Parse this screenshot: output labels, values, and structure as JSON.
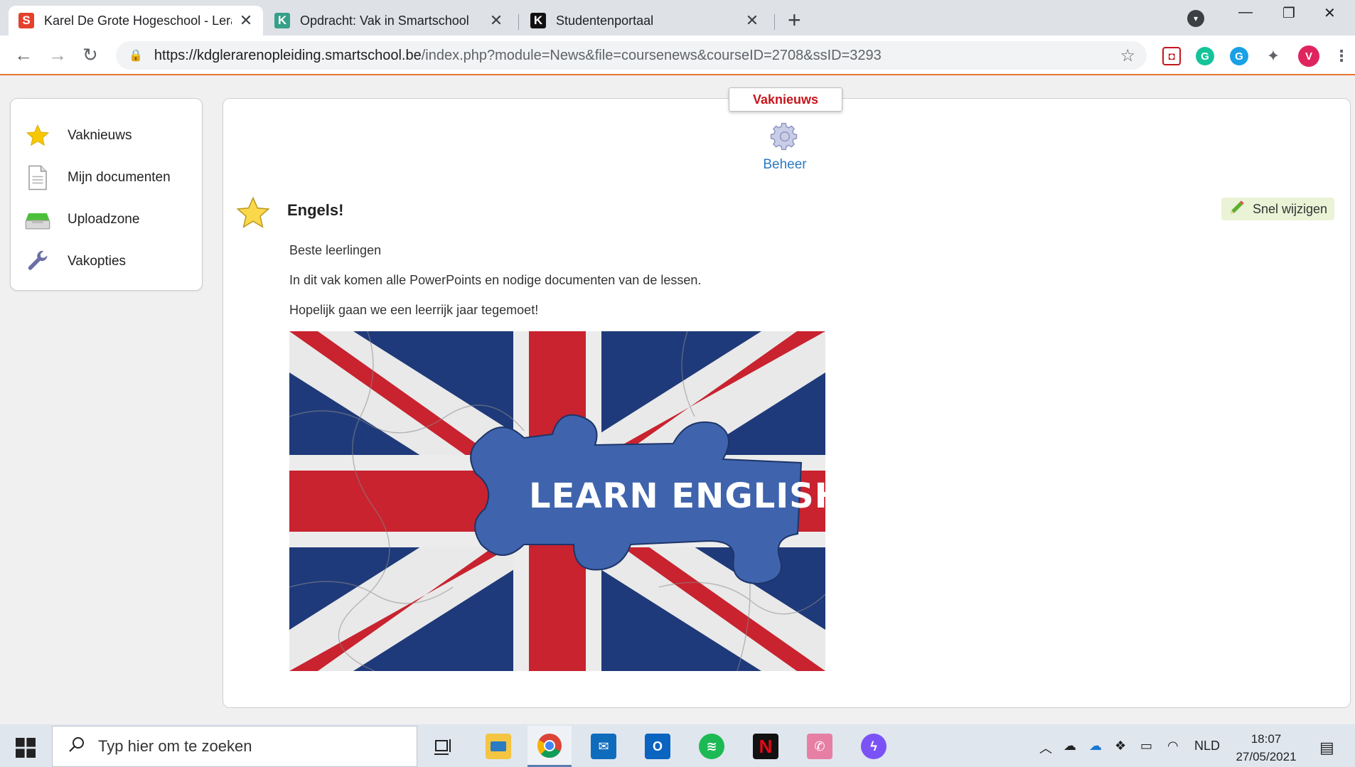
{
  "browser": {
    "tabs": [
      {
        "title": "Karel De Grote Hogeschool - Lera",
        "icon": "smartschool-icon",
        "color": "#e4402c",
        "letter": "S"
      },
      {
        "title": "Opdracht: Vak in Smartschool",
        "icon": "kdg-icon",
        "color": "#36a08a",
        "letter": "K"
      },
      {
        "title": "Studentenportaal",
        "icon": "kdg-icon",
        "color": "#111111",
        "letter": "K"
      }
    ],
    "url_host": "https://kdglerarenopleiding.smartschool.be",
    "url_rest": "/index.php?module=News&file=coursenews&courseID=2708&ssID=3293",
    "profile_initial": "V"
  },
  "sidebar": {
    "items": [
      {
        "label": "Vaknieuws",
        "icon": "star-icon"
      },
      {
        "label": "Mijn documenten",
        "icon": "document-icon"
      },
      {
        "label": "Uploadzone",
        "icon": "inbox-tray-icon"
      },
      {
        "label": "Vakopties",
        "icon": "wrench-icon"
      }
    ]
  },
  "main": {
    "tab_label": "Vaknieuws",
    "beheer_label": "Beheer",
    "post": {
      "title": "Engels!",
      "quick_edit_label": "Snel wijzigen",
      "paragraphs": [
        "Beste leerlingen",
        "In dit vak komen alle PowerPoints en nodige documenten van de lessen.",
        "Hopelijk gaan we een leerrijk jaar tegemoet!"
      ],
      "image_text": "LEARN ENGLISH"
    }
  },
  "taskbar": {
    "search_placeholder": "Typ hier om te zoeken",
    "apps": [
      {
        "name": "task-view",
        "color": "#dfe6ee"
      },
      {
        "name": "file-explorer",
        "color": "#f4c542"
      },
      {
        "name": "chrome",
        "color": "#db4437"
      },
      {
        "name": "mail",
        "color": "#0f6cbd"
      },
      {
        "name": "outlook",
        "color": "#0a64c0"
      },
      {
        "name": "spotify",
        "color": "#1db954"
      },
      {
        "name": "netflix",
        "color": "#111111"
      },
      {
        "name": "whatsapp",
        "color": "#e77fa5"
      },
      {
        "name": "messenger",
        "color": "#7b52f5"
      }
    ],
    "language": "NLD",
    "time": "18:07",
    "date": "27/05/2021"
  }
}
